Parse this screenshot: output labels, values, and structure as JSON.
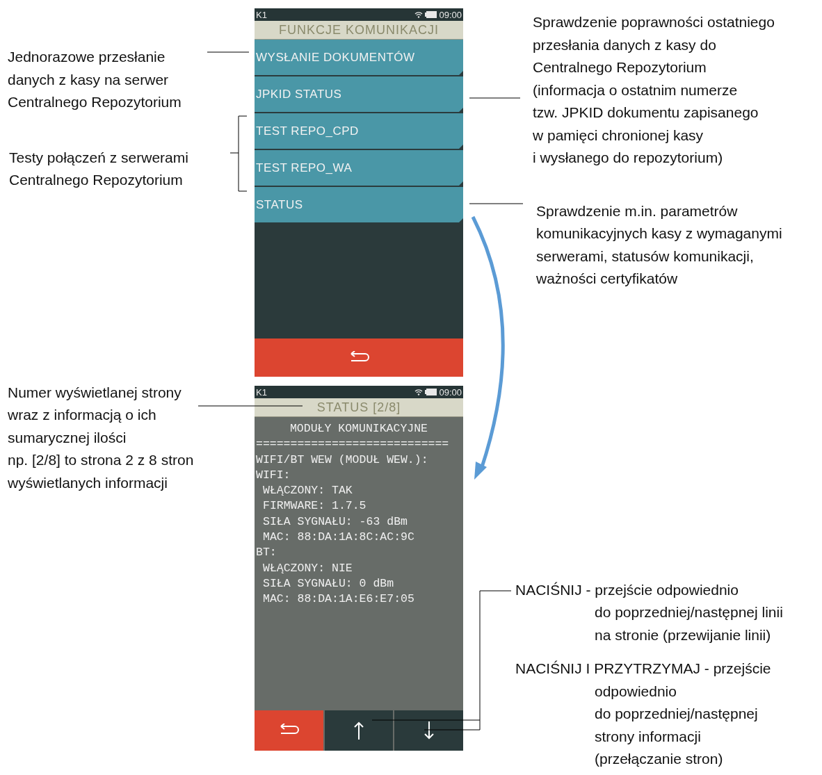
{
  "left_notes": [
    {
      "lines": [
        "Jednorazowe przesłanie",
        "danych z kasy na serwer",
        "Centralnego Repozytorium"
      ]
    },
    {
      "lines": [
        "Testy połączeń z serwerami",
        "Centralnego Repozytorium"
      ]
    },
    {
      "lines": [
        "Numer wyświetlanej strony",
        "wraz z informacją o ich",
        "sumarycznej ilości",
        "np. [2/8] to strona 2 z 8 stron",
        "wyświetlanych informacji"
      ]
    }
  ],
  "screens": [
    {
      "status_bar": {
        "left": "K1",
        "time": "09:00"
      },
      "title": "FUNKCJE KOMUNIKACJI",
      "menu_items": [
        {
          "label": "WYSŁANIE DOKUMENTÓW"
        },
        {
          "label": "JPKID STATUS"
        },
        {
          "label": "TEST REPO_CPD"
        },
        {
          "label": "TEST REPO_WA"
        },
        {
          "label": "STATUS"
        }
      ],
      "buttons": [
        {
          "kind": "back"
        }
      ]
    },
    {
      "status_bar": {
        "left": "K1",
        "time": "09:00"
      },
      "title": "STATUS [2/8]",
      "lines": [
        {
          "kind": "center",
          "text": "MODUŁY KOMUNIKACYJNE"
        },
        {
          "kind": "plain",
          "text": "============================"
        },
        {
          "kind": "plain",
          "text": "WIFI/BT WEW (MODUŁ WEW.):"
        },
        {
          "kind": "plain",
          "text": "WIFI:"
        },
        {
          "kind": "indent",
          "text": "WŁĄCZONY: TAK"
        },
        {
          "kind": "indent",
          "text": "FIRMWARE: 1.7.5"
        },
        {
          "kind": "indent",
          "text": "SIŁA SYGNAŁU: -63 dBm"
        },
        {
          "kind": "indent",
          "text": "MAC: 88:DA:1A:8C:AC:9C"
        },
        {
          "kind": "plain",
          "text": "BT:"
        },
        {
          "kind": "indent",
          "text": "WŁĄCZONY: NIE"
        },
        {
          "kind": "indent",
          "text": "SIŁA SYGNAŁU: 0 dBm"
        },
        {
          "kind": "indent",
          "text": "MAC: 88:DA:1A:E6:E7:05"
        }
      ],
      "buttons": [
        {
          "kind": "back"
        },
        {
          "kind": "up"
        },
        {
          "kind": "down"
        }
      ]
    }
  ],
  "right_notes": [
    {
      "lines": [
        "Sprawdzenie poprawności ostatniego",
        "przesłania danych z kasy do",
        "Centralnego Repozytorium",
        "(informacja o ostatnim numerze",
        "tzw. JPKID dokumentu zapisanego",
        "w pamięci chronionej kasy",
        "i wysłanego do repozytorium)"
      ]
    },
    {
      "lines": [
        "Sprawdzenie m.in. parametrów",
        "komunikacyjnych kasy z wymaganymi",
        "serwerami, statusów komunikacji,",
        "ważności certyfikatów"
      ]
    },
    {
      "lines": [
        "NACIŚNIJ - przejście odpowiednio",
        "do poprzedniej/następnej linii",
        "na stronie (przewijanie linii)"
      ]
    },
    {
      "lines": [
        "NACIŚNIJ I PRZYTRZYMAJ - przejście",
        "odpowiednio",
        "do poprzedniej/następnej",
        "strony informacji",
        "(przełączanie stron)"
      ]
    }
  ]
}
